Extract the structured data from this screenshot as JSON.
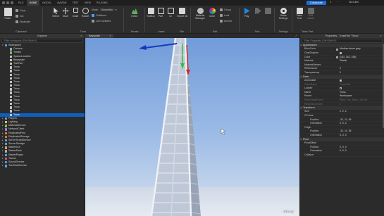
{
  "menubar": {
    "items": [
      "FILE",
      "HOME",
      "MODEL",
      "AVATAR",
      "TEST",
      "VIEW",
      "PLUGINS"
    ],
    "active": "HOME",
    "collaborate_label": "Collaborate",
    "user": "NurLuker"
  },
  "ribbon": {
    "clipboard": {
      "paste": "Paste",
      "copy": "Copy",
      "cut": "Cut",
      "duplicate": "Duplicate",
      "caption": "Clipboard"
    },
    "tools": {
      "select": "Select",
      "move": "Move",
      "scale": "Scale",
      "rotate": "Rotate",
      "mode_label": "Mode:",
      "mode_value": "Geometric",
      "collisions": "Collisions",
      "join_surfaces": "Join Surfaces",
      "caption": "Tools"
    },
    "terrain": {
      "editor": "Editor",
      "caption": "Terrain"
    },
    "insert": {
      "toolbox": "Toolbox",
      "part": "Part",
      "ui": "UI",
      "import3d": "Import 3D",
      "caption": "Insert"
    },
    "file": {
      "caption": "File"
    },
    "edit": {
      "material_manager": "Material Manager",
      "color": "Color",
      "group": "Group",
      "lock": "Lock",
      "anchor": "Anchor",
      "caption": "Edit"
    },
    "test": {
      "play": "Play",
      "resume": "",
      "stop": "",
      "caption": "Test"
    },
    "settings": {
      "game_settings": "Game Settings",
      "caption": "Settings"
    },
    "team_test": {
      "team_test": "Team Test",
      "exit_game": "Exit Game",
      "caption": "Team Test"
    }
  },
  "explorer": {
    "title": "Explorer",
    "filter_placeholder": "Filter workspace (Ctrl+Shift+X)",
    "items": [
      {
        "label": "Workspace",
        "depth": 0,
        "expanded": true,
        "icon_color": "#5aa0e6"
      },
      {
        "label": "Camera",
        "depth": 1,
        "icon_color": "#9bb0c4"
      },
      {
        "label": "Terrain",
        "depth": 1,
        "icon_color": "#7cbf5a"
      },
      {
        "label": "SpawnLocation",
        "depth": 1,
        "icon_color": "#c9c9c9"
      },
      {
        "label": "Baseplate",
        "depth": 1,
        "icon_color": "#c9c9c9"
      },
      {
        "label": "TestPart",
        "depth": 1,
        "icon_color": "#c9c9c9"
      },
      {
        "label": "Truss",
        "depth": 1,
        "icon_color": "#c9c9c9"
      },
      {
        "label": "Truss",
        "depth": 1,
        "icon_color": "#c9c9c9"
      },
      {
        "label": "Truss",
        "depth": 1,
        "icon_color": "#c9c9c9"
      },
      {
        "label": "Truss",
        "depth": 1,
        "icon_color": "#c9c9c9"
      },
      {
        "label": "Truss",
        "depth": 1,
        "icon_color": "#c9c9c9"
      },
      {
        "label": "Truss",
        "depth": 1,
        "icon_color": "#c9c9c9"
      },
      {
        "label": "Truss",
        "depth": 1,
        "icon_color": "#c9c9c9"
      },
      {
        "label": "Truss",
        "depth": 1,
        "icon_color": "#c9c9c9"
      },
      {
        "label": "Truss",
        "depth": 1,
        "icon_color": "#c9c9c9"
      },
      {
        "label": "Truss",
        "depth": 1,
        "icon_color": "#c9c9c9"
      },
      {
        "label": "Truss",
        "depth": 1,
        "icon_color": "#c9c9c9"
      },
      {
        "label": "Truss",
        "depth": 1,
        "icon_color": "#c9c9c9"
      },
      {
        "label": "Truss",
        "depth": 1,
        "icon_color": "#c9c9c9"
      },
      {
        "label": "Truss",
        "depth": 1,
        "icon_color": "#c9c9c9",
        "selected": true
      },
      {
        "label": "Players",
        "depth": 0,
        "icon_color": "#5aa0e6"
      },
      {
        "label": "Lighting",
        "depth": 0,
        "icon_color": "#f2c94c"
      },
      {
        "label": "MaterialService",
        "depth": 0,
        "icon_color": "#7cbf5a"
      },
      {
        "label": "NetworkClient",
        "depth": 0,
        "icon_color": "#9b7fd1"
      },
      {
        "label": "ReplicatedFirst",
        "depth": 0,
        "icon_color": "#e07b39"
      },
      {
        "label": "ReplicatedStorage",
        "depth": 0,
        "icon_color": "#e07b39"
      },
      {
        "label": "ServerScriptService",
        "depth": 0,
        "icon_color": "#5aa0e6"
      },
      {
        "label": "ServerStorage",
        "depth": 0,
        "icon_color": "#5aa0e6"
      },
      {
        "label": "StarterGui",
        "depth": 0,
        "icon_color": "#e0a33a"
      },
      {
        "label": "StarterPack",
        "depth": 0,
        "icon_color": "#9bb0c4"
      },
      {
        "label": "StarterPlayer",
        "depth": 0,
        "icon_color": "#5aa0e6"
      },
      {
        "label": "Teams",
        "depth": 0,
        "icon_color": "#d95b5b"
      },
      {
        "label": "SoundService",
        "depth": 0,
        "icon_color": "#5aa0e6"
      },
      {
        "label": "TextChatService",
        "depth": 0,
        "icon_color": "#5aa0e6"
      }
    ]
  },
  "viewport": {
    "tab_label": "Baseplate"
  },
  "properties": {
    "title": "Properties - TrussPart \"Truss\"",
    "filter_placeholder": "Filter Properties (Ctrl+Shift+P)",
    "sections": [
      {
        "name": "Appearance",
        "rows": [
          {
            "name": "BrickColor",
            "value": "Medium stone grey",
            "swatch": "#a3a2a5"
          },
          {
            "name": "CastShadow",
            "value": "",
            "checkbox": true
          },
          {
            "name": "Color",
            "value": "[163, 162, 165]",
            "swatch": "#a3a2a5"
          },
          {
            "name": "Material",
            "value": "Plastic"
          },
          {
            "name": "MaterialVariant",
            "value": ""
          },
          {
            "name": "Reflectance",
            "value": "0"
          },
          {
            "name": "Transparency",
            "value": "0"
          }
        ]
      },
      {
        "name": "Data",
        "rows": [
          {
            "name": "Archivable",
            "value": "",
            "checkbox": true
          },
          {
            "name": "ClassName",
            "value": "TrussPart",
            "dim": true
          },
          {
            "name": "Locked",
            "value": "",
            "checkbox": false
          },
          {
            "name": "Name",
            "value": "Truss"
          },
          {
            "name": "Parent",
            "value": "Workspace"
          },
          {
            "name": "ResizeableFaces",
            "value": "Right, Top, Back, Left, Bo...",
            "dim": true
          },
          {
            "name": "ResizeIncrement",
            "value": "2",
            "dim": true
          }
        ]
      },
      {
        "name": "Transform",
        "rows": [
          {
            "name": "Size",
            "value": "2, 2, 2"
          },
          {
            "name": "CFrame",
            "value": ""
          },
          {
            "name": "Position",
            "value": "-31, 11, 45",
            "sub": true
          },
          {
            "name": "Orientation",
            "value": "0, 0, 0",
            "sub": true
          },
          {
            "name": "Origin",
            "value": ""
          },
          {
            "name": "Position",
            "value": "-31, 11, 45",
            "sub": true
          },
          {
            "name": "Orientation",
            "value": "0, 0, 0",
            "sub": true
          }
        ]
      },
      {
        "name": "Pivot",
        "rows": [
          {
            "name": "PivotOffset",
            "value": ""
          },
          {
            "name": "Position",
            "value": "0, 0, 0",
            "sub": true
          },
          {
            "name": "Orientation",
            "value": "0, 0, 0",
            "sub": true
          },
          {
            "name": "Collision",
            "value": ""
          }
        ]
      }
    ]
  },
  "watermark": "Udemy"
}
